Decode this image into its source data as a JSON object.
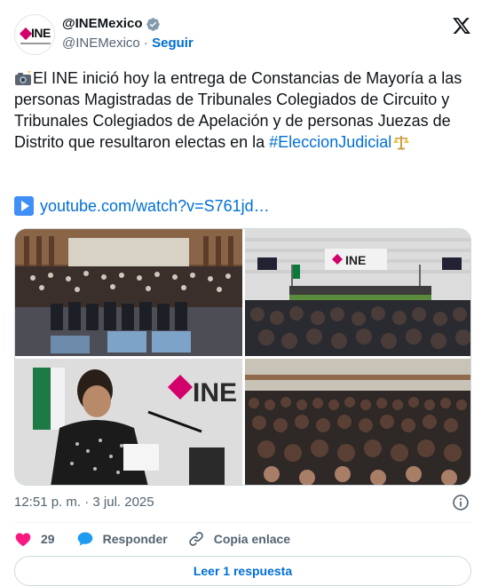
{
  "header": {
    "display_name": "@INEMexico",
    "handle": "@INEMexico",
    "separator": "·",
    "follow_label": "Seguir",
    "avatar_text": "INE"
  },
  "tweet": {
    "text_main": "El INE inició hoy la entrega de Constancias de Mayoría a las personas Magistradas de Tribunales Colegiados de Circuito y Tribunales Colegiados de Apelación y de personas Juezas de Distrito que resultaron electas en la ",
    "hashtag": "#EleccionJudicial",
    "link": "youtube.com/watch?v=S761jd…"
  },
  "photos": {
    "logo_text_2": "INE",
    "logo_text_3": "INE"
  },
  "meta": {
    "time": "12:51 p. m.",
    "dot": "·",
    "date": "3 jul. 2025"
  },
  "actions": {
    "likes": "29",
    "reply_label": "Responder",
    "copy_label": "Copia enlace"
  },
  "read_button": "Leer 1 respuesta",
  "colors": {
    "accent": "#006fd6",
    "like": "#f91880",
    "ine_pink": "#d3006b"
  }
}
